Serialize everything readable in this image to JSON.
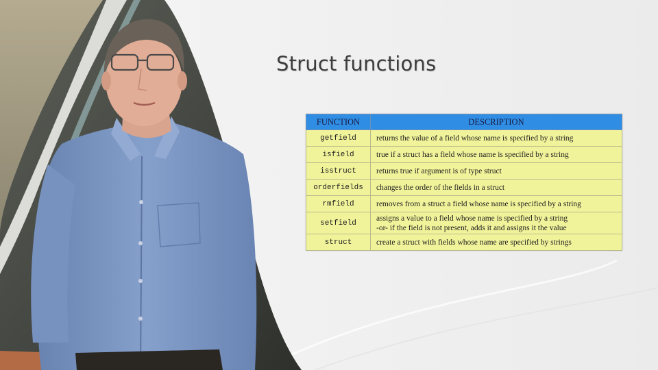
{
  "slide": {
    "title": "Struct functions"
  },
  "table": {
    "headers": [
      "FUNCTION",
      "DESCRIPTION"
    ],
    "rows": [
      {
        "function": "getfield",
        "description": [
          "returns the value of a field whose name is specified by a string"
        ]
      },
      {
        "function": "isfield",
        "description": [
          "true if a struct has a field whose name is specified by a string"
        ]
      },
      {
        "function": "isstruct",
        "description": [
          "returns true if argument is of type struct"
        ]
      },
      {
        "function": "orderfields",
        "description": [
          "changes the order of the fields in a struct"
        ]
      },
      {
        "function": "rmfield",
        "description": [
          "removes from a struct a field whose name is specified by a string"
        ]
      },
      {
        "function": "setfield",
        "description": [
          "assigns a value to a field whose name is specified by a string",
          "-or- if the field is not present, adds it and assigns it the value"
        ]
      },
      {
        "function": "struct",
        "description": [
          "create a struct with fields whose name are specified by strings"
        ]
      }
    ]
  },
  "colors": {
    "header_bg": "#2f8de4",
    "cell_bg": "#f1f39b",
    "shirt": "#7f9ac6",
    "background": "#efefef"
  }
}
